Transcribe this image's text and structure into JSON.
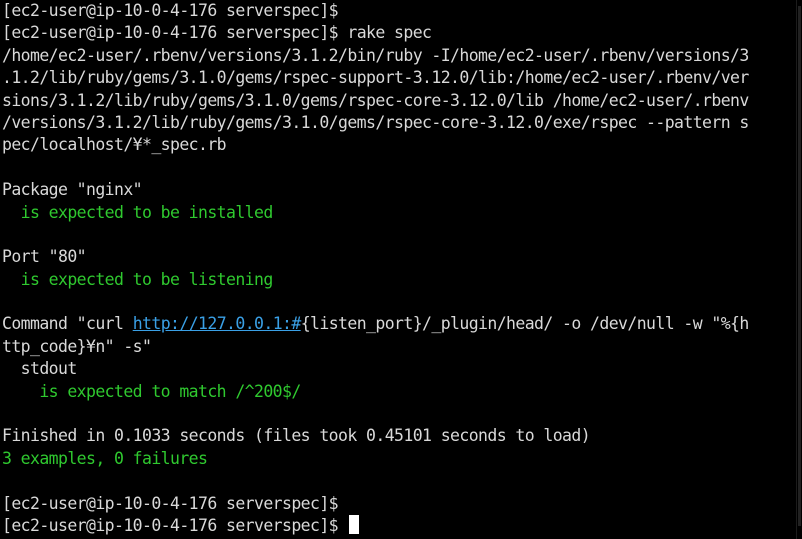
{
  "prompt": "[ec2-user@ip-10-0-4-176 serverspec]$",
  "command": "rake spec",
  "ruby_cmd": [
    "/home/ec2-user/.rbenv/versions/3.1.2/bin/ruby -I/home/ec2-user/.rbenv/versions/3",
    ".1.2/lib/ruby/gems/3.1.0/gems/rspec-support-3.12.0/lib:/home/ec2-user/.rbenv/ver",
    "sions/3.1.2/lib/ruby/gems/3.1.0/gems/rspec-core-3.12.0/lib /home/ec2-user/.rbenv",
    "/versions/3.1.2/lib/ruby/gems/3.1.0/gems/rspec-core-3.12.0/exe/rspec --pattern s",
    "pec/localhost/¥*_spec.rb"
  ],
  "package_header": "Package \"nginx\"",
  "package_result": "  is expected to be installed",
  "port_header": "Port \"80\"",
  "port_result": "  is expected to be listening",
  "command_prefix": "Command \"curl ",
  "command_link": "http://127.0.0.1:#",
  "command_rest": "{listen_port}/_plugin/head/ -o /dev/null -w \"%{h",
  "command_line2": "ttp_code}¥n\" -s\"",
  "stdout_label": "  stdout",
  "stdout_result": "    is expected to match /^200$/",
  "finished": "Finished in 0.1033 seconds (files took 0.45101 seconds to load)",
  "summary": "3 examples, 0 failures",
  "colors": {
    "background": "#000000",
    "text": "#d9d9d9",
    "success": "#2fc92f",
    "link": "#3aa0e6",
    "cursor": "#ffffff"
  }
}
